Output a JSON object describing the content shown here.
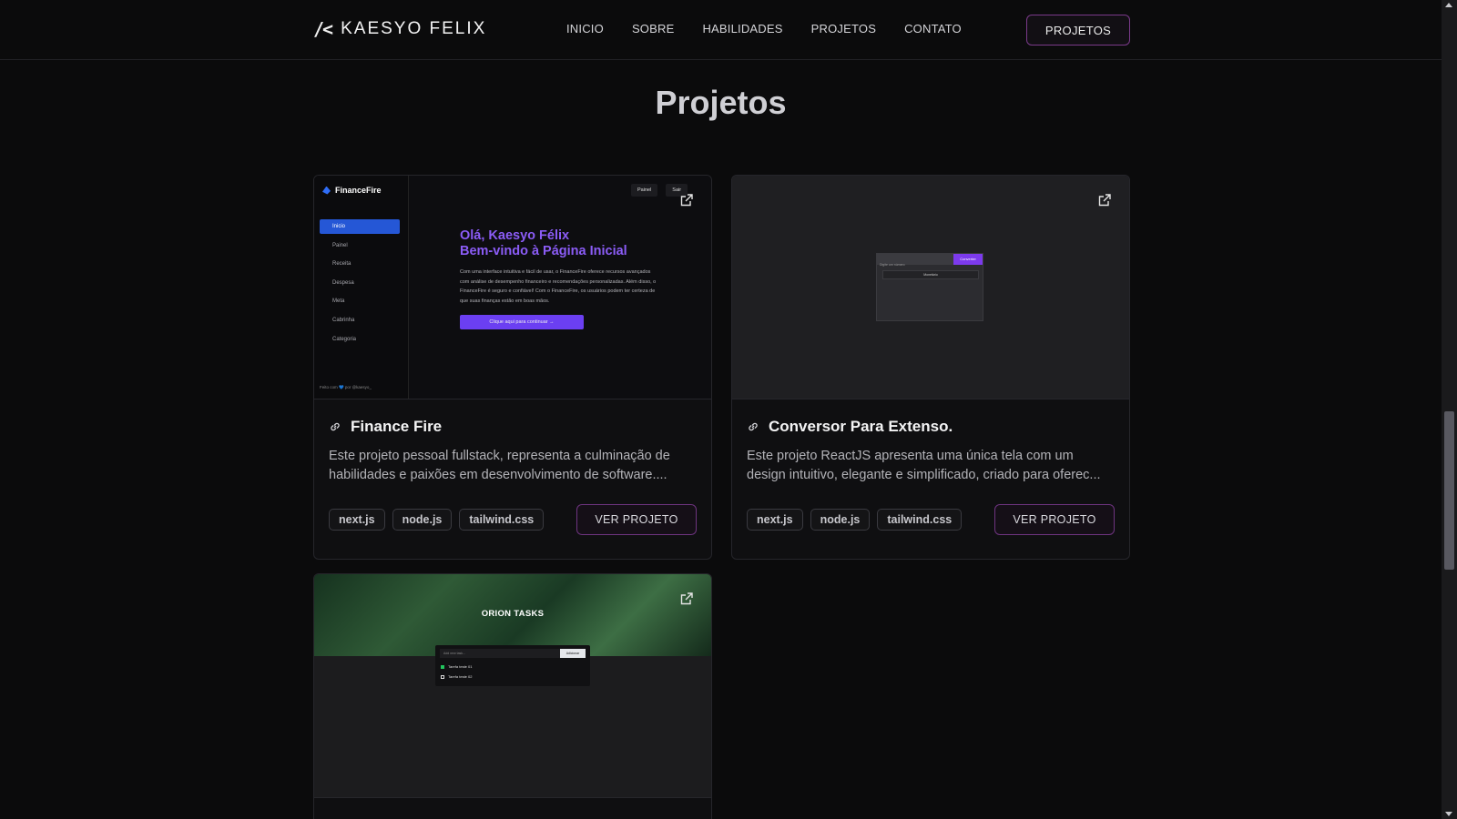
{
  "header": {
    "logo_mark": "/<",
    "logo_text": "KAESYO FELIX",
    "nav": [
      "INICIO",
      "SOBRE",
      "HABILIDADES",
      "PROJETOS",
      "CONTATO"
    ],
    "cta_label": "PROJETOS"
  },
  "section": {
    "title": "Projetos"
  },
  "projects": [
    {
      "title": "Finance Fire",
      "description": "Este projeto pessoal fullstack, representa a culminação de habilidades e paixões em desenvolvimento de software....",
      "tags": [
        "next.js",
        "node.js",
        "tailwind.css"
      ],
      "button_label": "VER PROJETO",
      "preview": {
        "brand": "FinanceFire",
        "menu": [
          "Inicio",
          "Painel",
          "Receita",
          "Despesa",
          "Meta",
          "Cabrinha",
          "Categoria"
        ],
        "heading_line1": "Olá, Kaesyo Félix",
        "heading_line2": "Bem-vindo à Página Inicial",
        "paragraph": "Com uma interface intuitiva e fácil de usar, o FinanceFire oferece recursos avançados com análise de desempenho financeiro e recomendações personalizadas. Além disso, o FinanceFire é seguro e confiável! Com o FinanceFire, os usuários podem ter certeza de que suas finanças estão em boas mãos.",
        "cta": "Clique aqui para continuar →",
        "top_pill_1": "Painel",
        "top_pill_2": "Sair",
        "footer": "Feito com 💙 por @kaesyo_"
      }
    },
    {
      "title": "Conversor Para Extenso.",
      "description": "Este projeto ReactJS apresenta uma única tela com um design intuitivo, elegante e simplificado, criado para oferec...",
      "tags": [
        "next.js",
        "node.js",
        "tailwind.css"
      ],
      "button_label": "VER PROJETO",
      "preview": {
        "input_placeholder": "Digite um número",
        "button": "Converter",
        "row_label": "Monetário"
      }
    },
    {
      "title": "",
      "description": "",
      "tags": [],
      "button_label": "",
      "preview": {
        "title": "ORION TASKS",
        "input_placeholder": "Add new task...",
        "add_button": "Adicionar",
        "tasks": [
          "Tarefa teste 01",
          "Tarefa teste 02"
        ]
      }
    }
  ],
  "colors": {
    "background": "#0b0b0c",
    "card_border": "#26262b",
    "button_border": "#7a3a8a",
    "accent_purple": "#8b5cf6"
  }
}
